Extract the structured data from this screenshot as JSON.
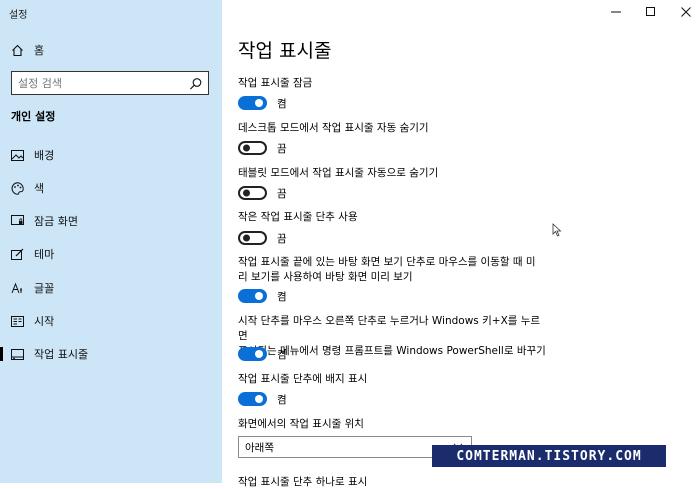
{
  "window": {
    "app_title": "설정"
  },
  "sidebar": {
    "home_label": "홈",
    "search_placeholder": "설정 검색",
    "section_title": "개인 설정",
    "items": [
      {
        "label": "배경",
        "icon": "picture-icon"
      },
      {
        "label": "색",
        "icon": "palette-icon"
      },
      {
        "label": "잠금 화면",
        "icon": "lock-screen-icon"
      },
      {
        "label": "테마",
        "icon": "brush-icon"
      },
      {
        "label": "글꼴",
        "icon": "font-icon"
      },
      {
        "label": "시작",
        "icon": "start-icon"
      },
      {
        "label": "작업 표시줄",
        "icon": "taskbar-icon",
        "active": true
      }
    ]
  },
  "main": {
    "title": "작업 표시줄",
    "settings": [
      {
        "label": "작업 표시줄 잠금",
        "state": "켬",
        "on": true
      },
      {
        "label": "데스크톱 모드에서 작업 표시줄 자동 숨기기",
        "state": "끔",
        "on": false
      },
      {
        "label": "태블릿 모드에서 작업 표시줄 자동으로 숨기기",
        "state": "끔",
        "on": false
      },
      {
        "label": "작은 작업 표시줄 단추 사용",
        "state": "끔",
        "on": false
      },
      {
        "label_line1": "작업 표시줄 끝에 있는 바탕 화면 보기 단추로 마우스를 이동할 때 미",
        "label_line2": "리 보기를 사용하여 바탕 화면 미리 보기",
        "state": "켬",
        "on": true
      },
      {
        "label_line1": "시작 단추를 마우스 오른쪽 단추로 누르거나 Windows 키+X를 누르면",
        "label_line2": "표시되는 메뉴에서 명령 프롬프트를 Windows PowerShell로 바꾸기",
        "state": "켬",
        "on": true
      },
      {
        "label": "작업 표시줄 단추에 배지 표시",
        "state": "켬",
        "on": true
      }
    ],
    "position_label": "화면에서의 작업 표시줄 위치",
    "position_value": "아래쪽",
    "partial_label": "작업 표시줄 단추 하나로 표시"
  },
  "watermark": "COMTERMAN.TISTORY.COM",
  "colors": {
    "sidebar_bg": "#cde6f7",
    "toggle_on": "#0a6fd6",
    "watermark_bg": "#1a2c6b"
  }
}
